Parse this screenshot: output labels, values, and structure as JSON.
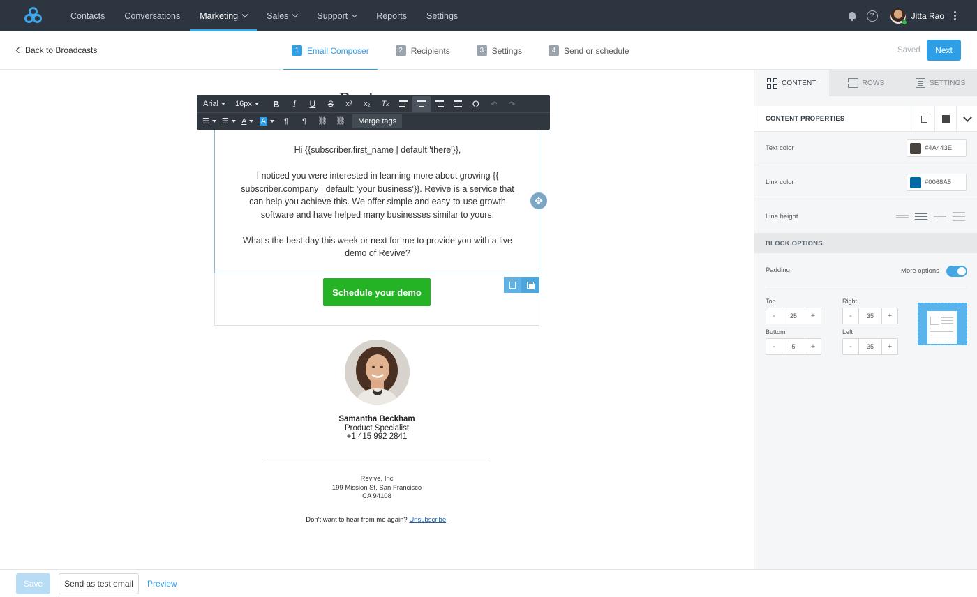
{
  "nav": {
    "items": [
      {
        "label": "Contacts",
        "dropdown": false,
        "active": false
      },
      {
        "label": "Conversations",
        "dropdown": false,
        "active": false
      },
      {
        "label": "Marketing",
        "dropdown": true,
        "active": true
      },
      {
        "label": "Sales",
        "dropdown": true,
        "active": false
      },
      {
        "label": "Support",
        "dropdown": true,
        "active": false
      },
      {
        "label": "Reports",
        "dropdown": false,
        "active": false
      },
      {
        "label": "Settings",
        "dropdown": false,
        "active": false
      }
    ],
    "user_name": "Jitta Rao",
    "accent": "#3aa6e8"
  },
  "subheader": {
    "back_label": "Back to Broadcasts",
    "steps": [
      {
        "num": "1",
        "label": "Email Composer",
        "active": true
      },
      {
        "num": "2",
        "label": "Recipients",
        "active": false
      },
      {
        "num": "3",
        "label": "Settings",
        "active": false
      },
      {
        "num": "4",
        "label": "Send or schedule",
        "active": false
      }
    ],
    "saved_label": "Saved",
    "next_label": "Next"
  },
  "editor": {
    "partial_heading": "Revive",
    "toolbar": {
      "font": "Arial",
      "size": "16px",
      "merge_tags": "Merge tags"
    },
    "paragraphs": [
      "Hi {{subscriber.first_name | default:'there'}},",
      "I noticed you were interested in learning more about growing {{ subscriber.company | default: 'your business'}}. Revive is a service that can help you achieve this. We offer simple and easy-to-use growth software and have helped many businesses similar to yours.",
      "What's the best day this week or next for me to provide you with a live demo of Revive?"
    ],
    "cta_label": "Schedule your demo",
    "cta_color": "#23b324",
    "signature": {
      "name": "Samantha Beckham",
      "title": "Product Specialist",
      "phone": "+1 415 992 2841"
    },
    "footer": {
      "company": "Revive, Inc",
      "street": "199 Mission St, San Francisco",
      "region": "CA 94108",
      "unsub_prefix": "Don't want to hear from me again? ",
      "unsub_link": "Unsubscribe",
      "unsub_suffix": "."
    }
  },
  "panel": {
    "tabs": [
      {
        "label": "CONTENT",
        "icon": "content-grid-icon",
        "active": true
      },
      {
        "label": "ROWS",
        "icon": "rows-icon",
        "active": false
      },
      {
        "label": "SETTINGS",
        "icon": "settings-doc-icon",
        "active": false
      }
    ],
    "content_properties": "CONTENT PROPERTIES",
    "text_color_label": "Text color",
    "text_color": "#4A443E",
    "link_color_label": "Link color",
    "link_color": "#0068A5",
    "line_height_label": "Line height",
    "block_options": "BLOCK OPTIONS",
    "padding_label": "Padding",
    "more_options": "More options",
    "more_options_on": true,
    "padding": {
      "top_label": "Top",
      "top": "25",
      "right_label": "Right",
      "right": "35",
      "bottom_label": "Bottom",
      "bottom": "5",
      "left_label": "Left",
      "left": "35"
    }
  },
  "bottom": {
    "save": "Save",
    "test": "Send as test email",
    "preview": "Preview"
  }
}
